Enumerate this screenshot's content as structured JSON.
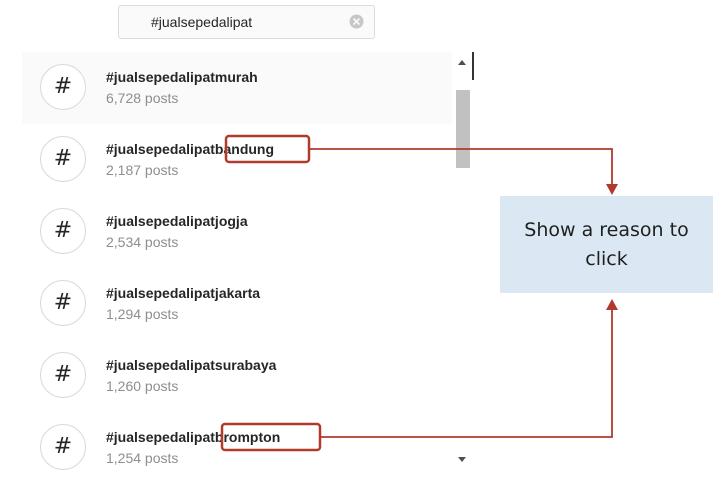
{
  "search": {
    "value": "#jualsepedalipat",
    "clear_icon": "clear-circle-icon"
  },
  "results": [
    {
      "icon": "#",
      "tag": "#jualsepedalipatmurah",
      "count": "6,728 posts"
    },
    {
      "icon": "#",
      "tag": "#jualsepedalipatbandung",
      "count": "2,187 posts"
    },
    {
      "icon": "#",
      "tag": "#jualsepedalipatjogja",
      "count": "2,534 posts"
    },
    {
      "icon": "#",
      "tag": "#jualsepedalipatjakarta",
      "count": "1,294 posts"
    },
    {
      "icon": "#",
      "tag": "#jualsepedalipatsurabaya",
      "count": "1,260 posts"
    },
    {
      "icon": "#",
      "tag": "#jualsepedalipatbrompton",
      "count": "1,254 posts"
    }
  ],
  "callout": {
    "text": "Show a reason to click"
  },
  "colors": {
    "annotation": "#b03a2e",
    "callout_bg": "#dbe8f4",
    "muted_text": "#8e8e8e"
  }
}
